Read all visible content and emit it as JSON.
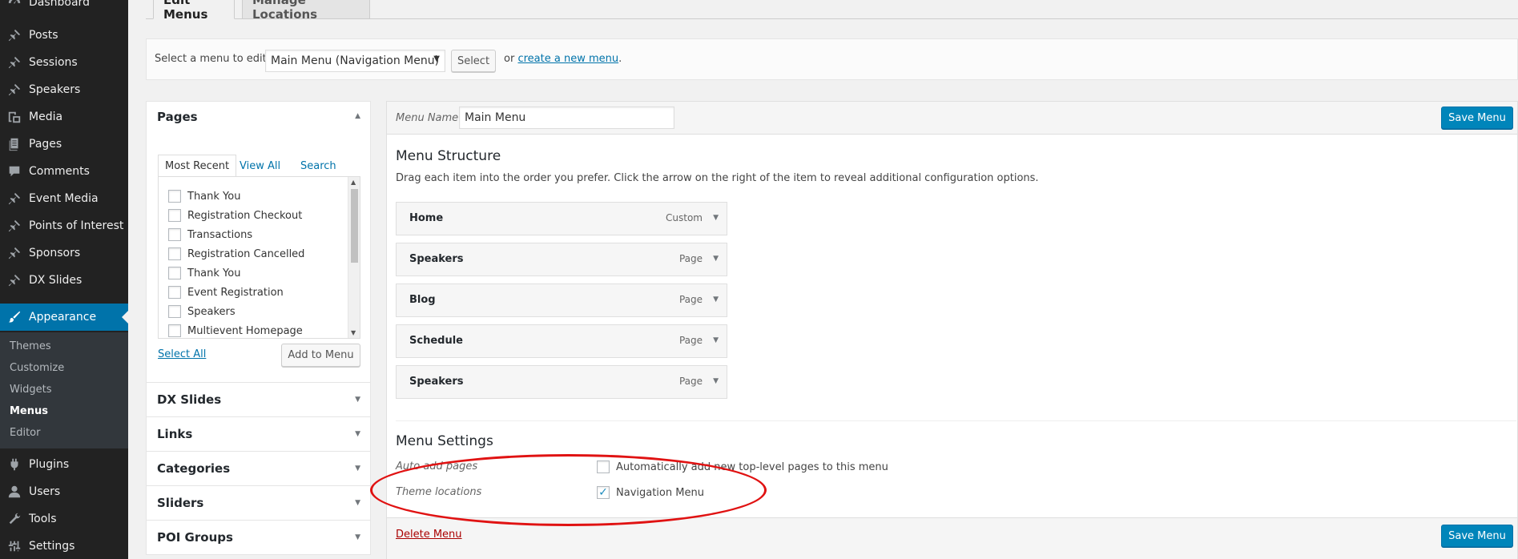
{
  "sidebar": {
    "items": [
      {
        "label": "Dashboard",
        "icon": "dashboard-icon"
      },
      {
        "label": "Posts",
        "icon": "pushpin-icon"
      },
      {
        "label": "Sessions",
        "icon": "pushpin-icon"
      },
      {
        "label": "Speakers",
        "icon": "pushpin-icon"
      },
      {
        "label": "Media",
        "icon": "media-icon"
      },
      {
        "label": "Pages",
        "icon": "pages-icon"
      },
      {
        "label": "Comments",
        "icon": "comment-icon"
      },
      {
        "label": "Event Media",
        "icon": "pushpin-icon"
      },
      {
        "label": "Points of Interest",
        "icon": "pushpin-icon"
      },
      {
        "label": "Sponsors",
        "icon": "pushpin-icon"
      },
      {
        "label": "DX Slides",
        "icon": "pushpin-icon"
      },
      {
        "label": "Appearance",
        "icon": "paintbrush-icon"
      },
      {
        "label": "Plugins",
        "icon": "plugin-icon"
      },
      {
        "label": "Users",
        "icon": "users-icon"
      },
      {
        "label": "Tools",
        "icon": "wrench-icon"
      },
      {
        "label": "Settings",
        "icon": "settings-icon"
      }
    ],
    "submenu": [
      "Themes",
      "Customize",
      "Widgets",
      "Menus",
      "Editor"
    ],
    "accent_color": "#0073aa"
  },
  "tabs": {
    "edit": "Edit Menus",
    "manage": "Manage Locations"
  },
  "select_bar": {
    "label": "Select a menu to edit:",
    "selected": "Main Menu (Navigation Menu)",
    "select_button": "Select",
    "or_text": "or",
    "create_link": "create a new menu",
    "period": "."
  },
  "pages_box": {
    "title": "Pages",
    "tabs": [
      "Most Recent",
      "View All",
      "Search"
    ],
    "items": [
      "Thank You",
      "Registration Checkout",
      "Transactions",
      "Registration Cancelled",
      "Thank You",
      "Event Registration",
      "Speakers",
      "Multievent Homepage"
    ],
    "select_all": "Select All",
    "add_button": "Add to Menu"
  },
  "other_sections": [
    "DX Slides",
    "Links",
    "Categories",
    "Sliders",
    "POI Groups"
  ],
  "menu_editor": {
    "name_label": "Menu Name",
    "name_value": "Main Menu",
    "save_button": "Save Menu",
    "structure_title": "Menu Structure",
    "structure_desc": "Drag each item into the order you prefer. Click the arrow on the right of the item to reveal additional configuration options.",
    "items": [
      {
        "title": "Home",
        "type": "Custom"
      },
      {
        "title": "Speakers",
        "type": "Page"
      },
      {
        "title": "Blog",
        "type": "Page"
      },
      {
        "title": "Schedule",
        "type": "Page"
      },
      {
        "title": "Speakers",
        "type": "Page"
      }
    ],
    "settings_title": "Menu Settings",
    "auto_add_label": "Auto add pages",
    "auto_add_text": "Automatically add new top-level pages to this menu",
    "auto_add_checked": false,
    "locations_label": "Theme locations",
    "location_name": "Navigation Menu",
    "location_checked": true,
    "delete_link": "Delete Menu"
  },
  "annotation_color": "#e01212"
}
